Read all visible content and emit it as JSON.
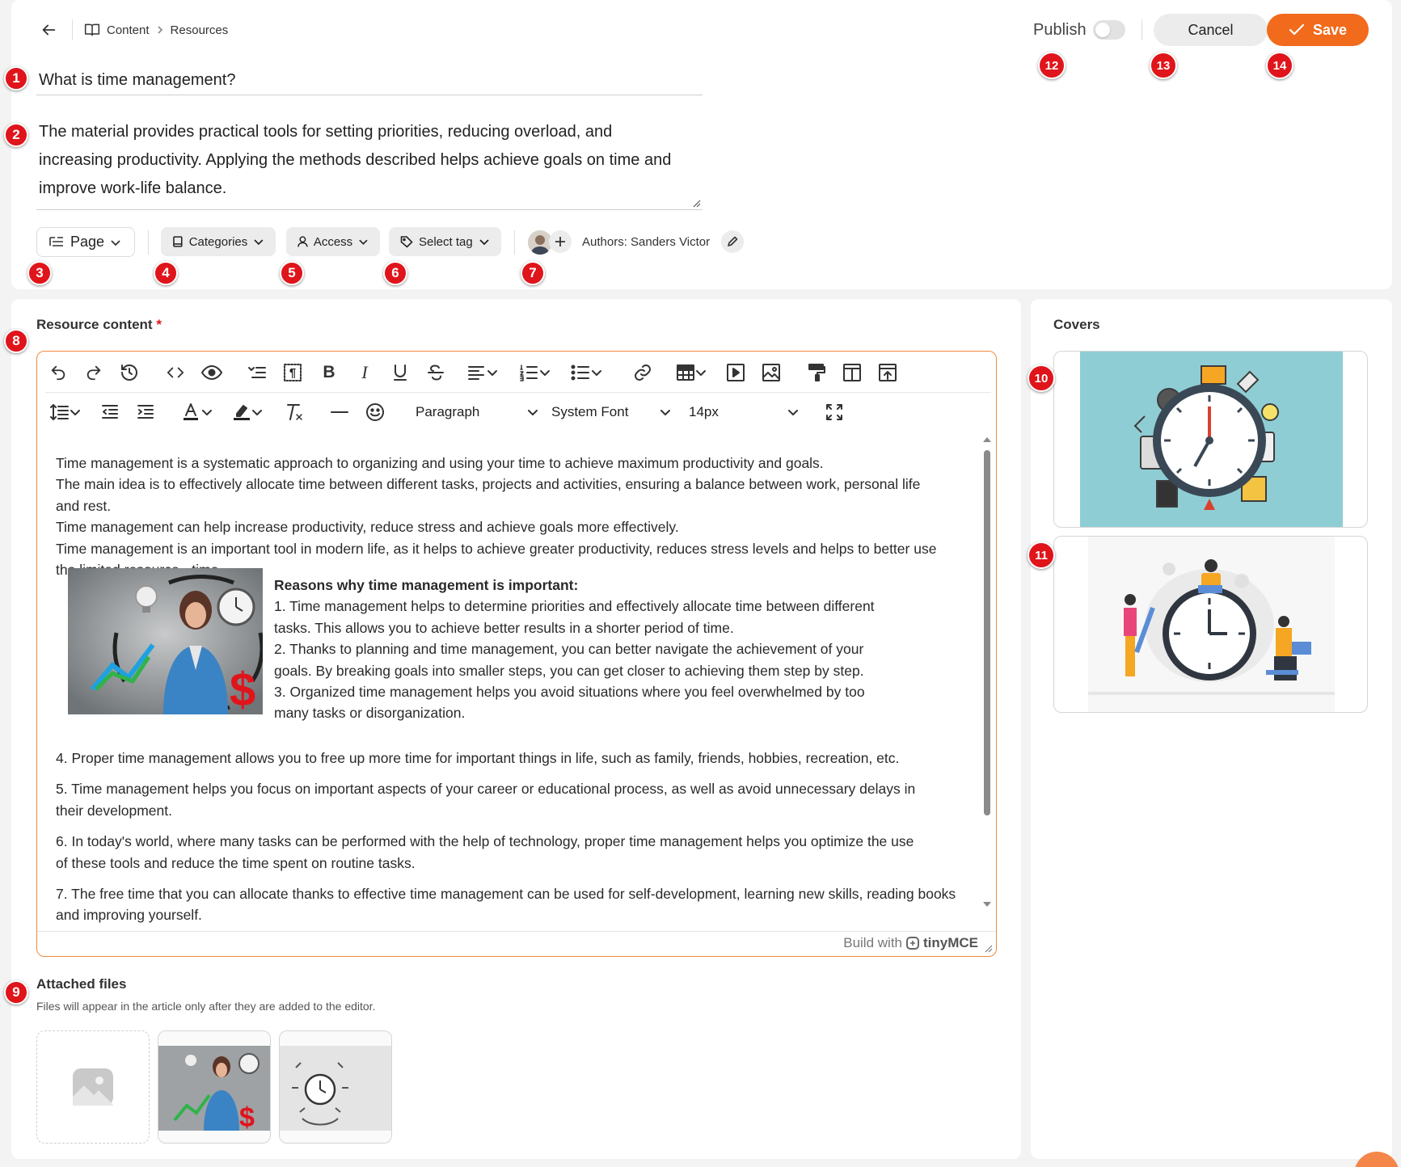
{
  "header": {
    "breadcrumb": [
      "Content",
      "Resources"
    ],
    "publish_label": "Publish",
    "cancel_label": "Cancel",
    "save_label": "Save"
  },
  "form": {
    "title": "What is time management?",
    "description": "The material provides practical tools for setting priorities, reducing overload, and increasing productivity. Applying the methods described helps achieve goals on time and improve work-life balance.",
    "page_select": "Page",
    "categories_label": "Categories",
    "access_label": "Access",
    "tag_label": "Select tag",
    "authors_label": "Authors: Sanders Victor"
  },
  "badges": [
    "1",
    "2",
    "3",
    "4",
    "5",
    "6",
    "7",
    "8",
    "9",
    "10",
    "11",
    "12",
    "13",
    "14"
  ],
  "editor": {
    "section_label": "Resource content",
    "required_mark": "*",
    "block_format": "Paragraph",
    "font_family": "System Font",
    "font_size": "14px",
    "footer": "Build with",
    "brand": "tinyMCE",
    "paragraphs_top": [
      "Time management is a systematic approach to organizing and using your time to achieve maximum productivity and goals.",
      "The main idea is to effectively allocate time between different tasks, projects and activities, ensuring a balance between work, personal life and rest.",
      "Time management can help increase productivity, reduce stress and achieve goals more effectively.",
      "Time management is an important tool in modern life, as it helps to achieve greater productivity, reduces stress levels and helps to better use the limited resource - time."
    ],
    "reasons_title": "Reasons why time management is important:",
    "reasons_wrapped": [
      "1. Time management helps to determine priorities and effectively allocate time between different tasks. This allows you to achieve better results in a shorter period of time.",
      "2. Thanks to planning and time management, you can better navigate the achievement of your goals. By breaking goals into smaller steps, you can get closer to achieving them step by step.",
      "3. Organized time management helps you avoid situations where you feel overwhelmed by too many tasks or disorganization."
    ],
    "reasons_full": [
      "4. Proper time management allows you to free up more time for important things in life, such as family, friends, hobbies, recreation, etc.",
      "5. Time management helps you focus on important aspects of your career or educational process, as well as avoid unnecessary delays in their development.",
      "6. In today's world, where many tasks can be performed with the help of technology, proper time management helps you optimize the use of these tools and reduce the time spent on routine tasks.",
      "7. The free time that you can allocate thanks to effective time management can be used for self-development, learning new skills, reading books and improving yourself."
    ]
  },
  "attachments": {
    "title": "Attached files",
    "hint": "Files will appear in the article only after they are added to the editor."
  },
  "covers": {
    "title": "Covers"
  },
  "colors": {
    "accent": "#f26a1b",
    "badge": "#e0141b",
    "cover_bg": "#8fcdd4"
  }
}
